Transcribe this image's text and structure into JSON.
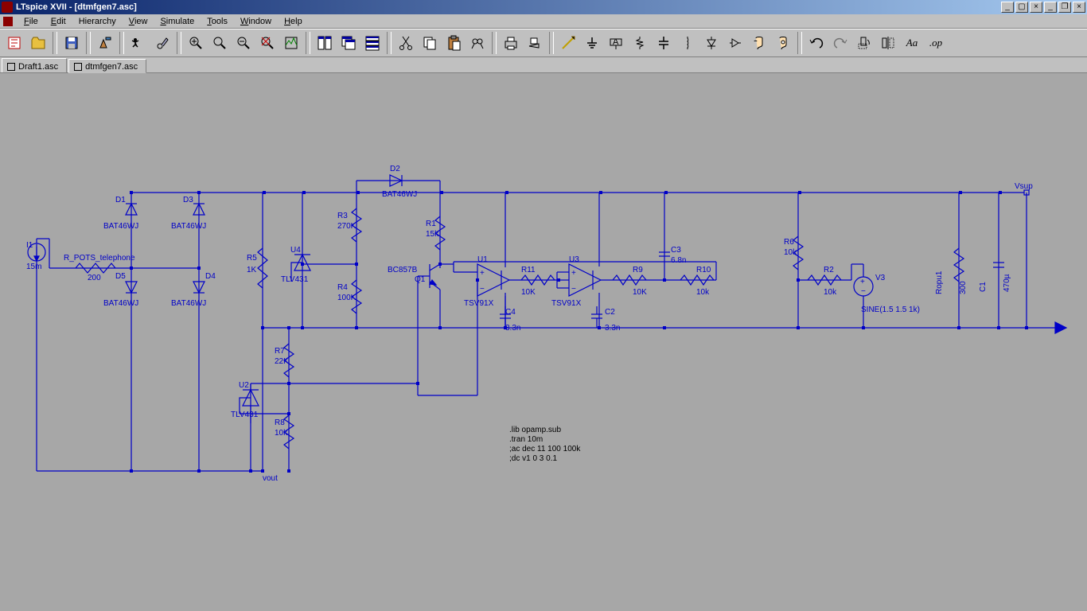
{
  "window": {
    "title": "LTspice XVII - [dtmfgen7.asc]"
  },
  "menu": {
    "file": "File",
    "edit": "Edit",
    "hierarchy": "Hierarchy",
    "view": "View",
    "simulate": "Simulate",
    "tools": "Tools",
    "window": "Window",
    "help": "Help"
  },
  "tabs": {
    "t1": "Draft1.asc",
    "t2": "dtmfgen7.asc"
  },
  "net": {
    "vsup": "Vsup",
    "vout": "vout"
  },
  "parts": {
    "I1": {
      "ref": "I1",
      "val": "15m"
    },
    "Rpots": {
      "ref": "R_POTS_telephone",
      "val": "200"
    },
    "D1": {
      "ref": "D1",
      "val": "BAT46WJ"
    },
    "D3": {
      "ref": "D3",
      "val": "BAT46WJ"
    },
    "D5": {
      "ref": "D5",
      "val": "BAT46WJ"
    },
    "D4": {
      "ref": "D4",
      "val": "BAT46WJ"
    },
    "D2": {
      "ref": "D2",
      "val": "BAT46WJ"
    },
    "R5": {
      "ref": "R5",
      "val": "1K"
    },
    "U4": {
      "ref": "U4",
      "val": "TLV431"
    },
    "R3": {
      "ref": "R3",
      "val": "270K"
    },
    "R4": {
      "ref": "R4",
      "val": "100K"
    },
    "R1": {
      "ref": "R1",
      "val": "15k"
    },
    "Q1": {
      "ref": "Q1",
      "val": "BC857B"
    },
    "U1": {
      "ref": "U1",
      "val": "TSV91X"
    },
    "U3": {
      "ref": "U3",
      "val": "TSV91X"
    },
    "R11": {
      "ref": "R11",
      "val": "10K"
    },
    "C4": {
      "ref": "C4",
      "val": "3.3n"
    },
    "C2": {
      "ref": "C2",
      "val": "3.3n"
    },
    "C3": {
      "ref": "C3",
      "val": "6.8n"
    },
    "R9": {
      "ref": "R9",
      "val": "10K"
    },
    "R10": {
      "ref": "R10",
      "val": "10k"
    },
    "R6": {
      "ref": "R6",
      "val": "10k"
    },
    "R2": {
      "ref": "R2",
      "val": "10k"
    },
    "V3": {
      "ref": "V3",
      "val": "SINE(1.5 1.5 1k)"
    },
    "Ropu1": {
      "ref": "Ropu1",
      "val": "300"
    },
    "C1": {
      "ref": "C1",
      "val": "470µ"
    },
    "R7": {
      "ref": "R7",
      "val": "22K"
    },
    "R8": {
      "ref": "R8",
      "val": "10k"
    },
    "U2": {
      "ref": "U2",
      "val": "TLV431"
    }
  },
  "spice": {
    "l1": ".lib opamp.sub",
    "l2": ".tran 10m",
    "l3": ";ac dec 11 100 100k",
    "l4": ";dc v1 0 3 0.1"
  }
}
